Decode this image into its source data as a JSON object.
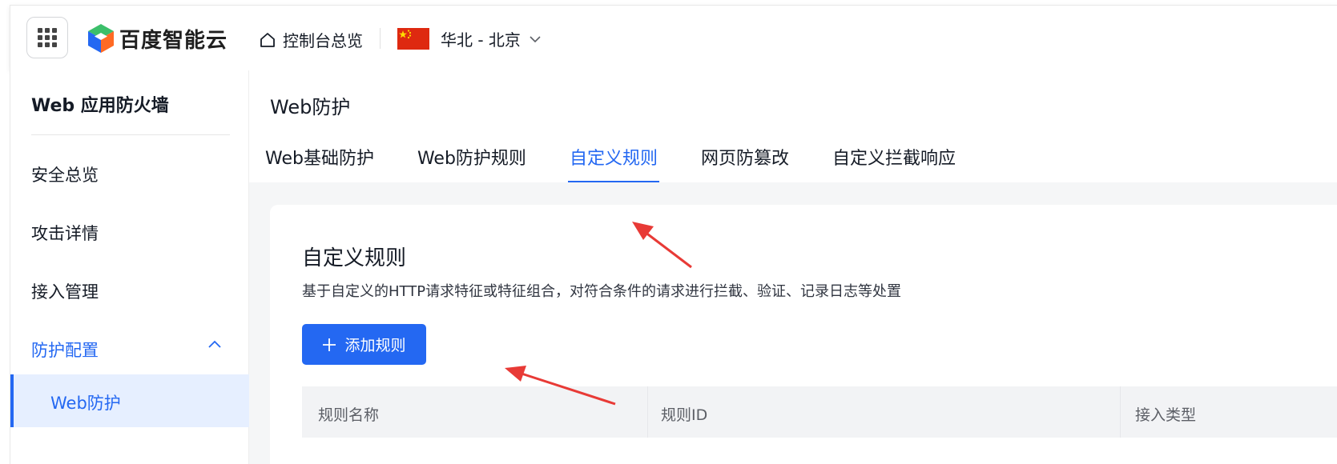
{
  "header": {
    "brand": "百度智能云",
    "console_label": "控制台总览",
    "region_label": "华北 - 北京"
  },
  "sidebar": {
    "title": "Web 应用防火墙",
    "items": [
      {
        "label": "安全总览"
      },
      {
        "label": "攻击详情"
      },
      {
        "label": "接入管理"
      },
      {
        "label": "防护配置"
      }
    ],
    "sub_item": "Web防护"
  },
  "main": {
    "page_title": "Web防护",
    "tabs": [
      {
        "label": "Web基础防护"
      },
      {
        "label": "Web防护规则"
      },
      {
        "label": "自定义规则"
      },
      {
        "label": "网页防篡改"
      },
      {
        "label": "自定义拦截响应"
      }
    ],
    "active_tab": "自定义规则"
  },
  "card": {
    "title": "自定义规则",
    "description": "基于自定义的HTTP请求特征或特征组合，对符合条件的请求进行拦截、验证、记录日志等处置",
    "add_button": "添加规则",
    "table_headers": [
      "规则名称",
      "规则ID",
      "接入类型"
    ]
  },
  "colors": {
    "accent": "#2468f2",
    "arrow": "#e83a36",
    "flag": "#de2910"
  }
}
